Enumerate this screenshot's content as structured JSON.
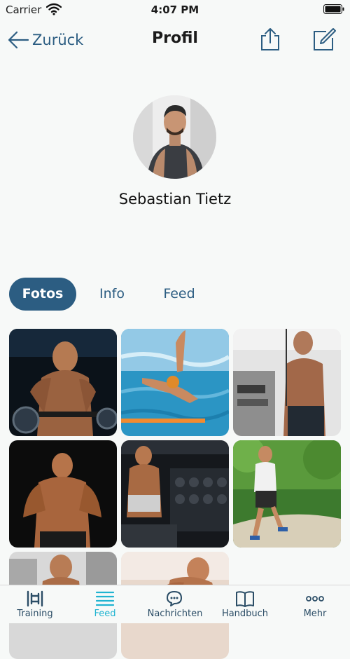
{
  "status": {
    "carrier": "Carrier",
    "time": "4:07 PM"
  },
  "nav": {
    "back_label": "Zurück",
    "title": "Profil"
  },
  "profile": {
    "name": "Sebastian Tietz"
  },
  "tabs": [
    {
      "label": "Fotos",
      "active": true
    },
    {
      "label": "Info",
      "active": false
    },
    {
      "label": "Feed",
      "active": false
    }
  ],
  "photos": [
    "barbell-curl",
    "swimmer",
    "cable-machine",
    "flexing",
    "gym-bench",
    "runner",
    "cable-machine-2",
    "athlete-partial"
  ],
  "tabbar": [
    {
      "label": "Training",
      "icon": "dumbbell-icon",
      "active": false
    },
    {
      "label": "Feed",
      "icon": "feed-lines-icon",
      "active": true
    },
    {
      "label": "Nachrichten",
      "icon": "chat-bubbles-icon",
      "active": false
    },
    {
      "label": "Handbuch",
      "icon": "book-icon",
      "active": false
    },
    {
      "label": "Mehr",
      "icon": "more-dots-icon",
      "active": false
    }
  ],
  "colors": {
    "accent": "#2c5d82",
    "tab_active": "#20b4d1",
    "background": "#f7f9f8"
  }
}
